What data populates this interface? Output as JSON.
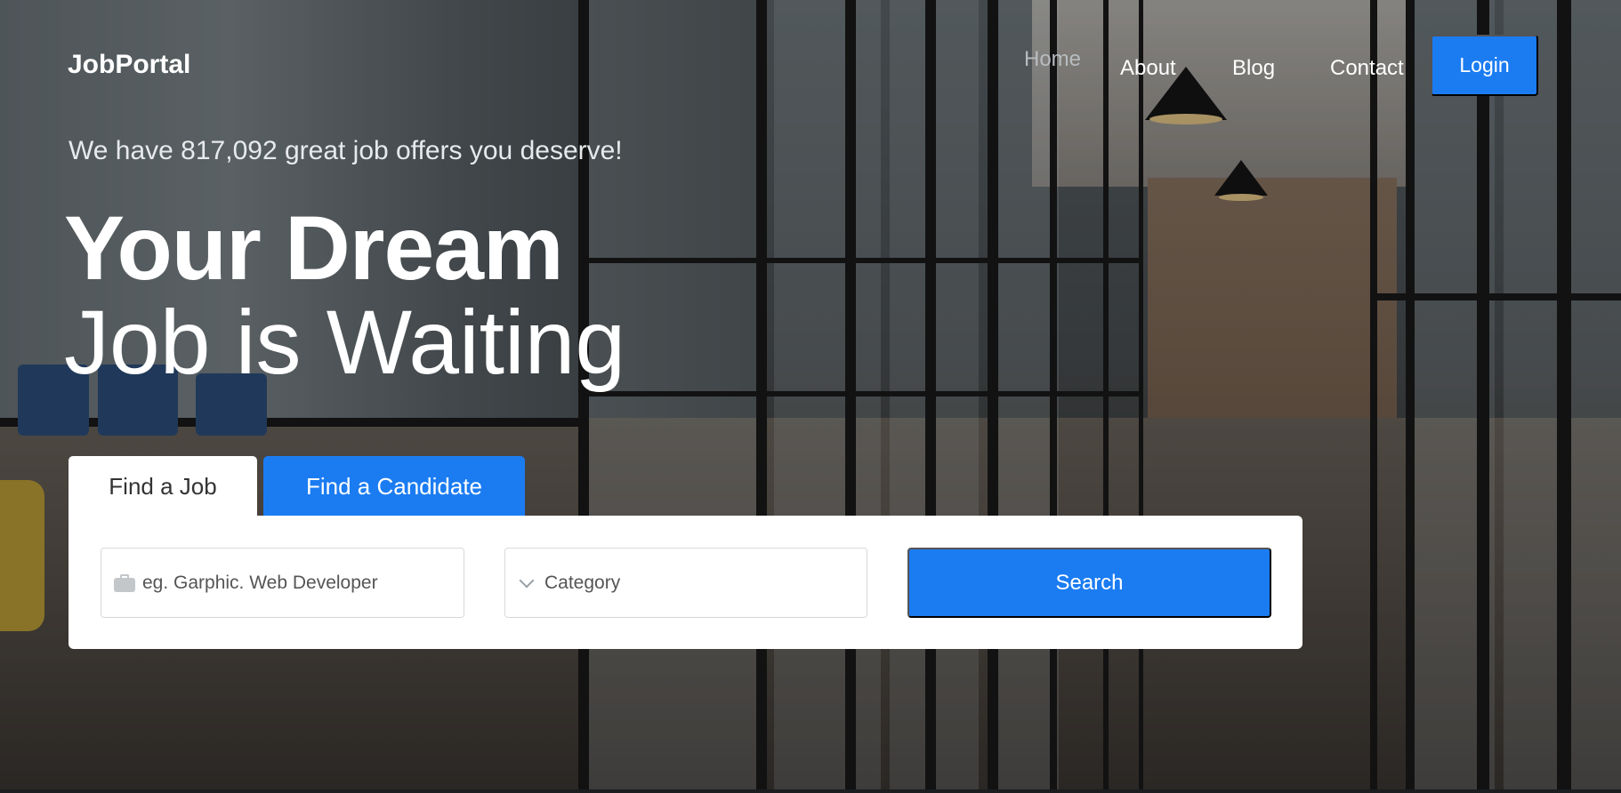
{
  "nav": {
    "logo": "JobPortal",
    "links": [
      {
        "label": "Home"
      },
      {
        "label": "About"
      },
      {
        "label": "Blog"
      },
      {
        "label": "Contact"
      }
    ],
    "login_label": "Login"
  },
  "hero": {
    "tagline": "We have 817,092 great job offers you deserve!",
    "headline_bold": "Your Dream",
    "headline_light": "Job is Waiting"
  },
  "tabs": {
    "find_job": "Find a Job",
    "find_candidate": "Find a Candidate"
  },
  "search": {
    "keyword_placeholder": "eg. Garphic. Web Developer",
    "category_placeholder": "Category",
    "button_label": "Search"
  },
  "colors": {
    "accent": "#1b7cf2"
  },
  "icons": {
    "keyword": "briefcase-icon",
    "category": "chevron-down-icon"
  }
}
